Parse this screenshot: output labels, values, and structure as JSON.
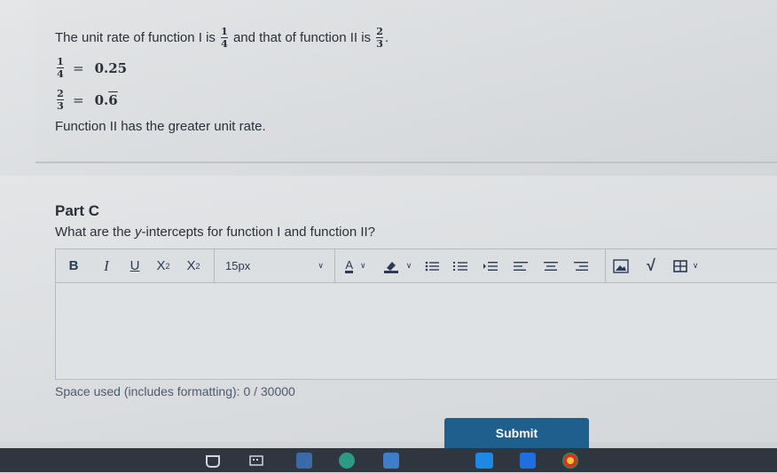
{
  "previous_answer": {
    "line1_prefix": "The unit rate of function I is",
    "line1_mid": "and that of function II is",
    "line1_end": ".",
    "frac1_num": "1",
    "frac1_den": "4",
    "frac2_num": "2",
    "frac2_den": "3",
    "row1_value": "0.25",
    "row2_value_base": "0.",
    "row2_value_repeat": "6",
    "eq_sign": "=",
    "conclusion": "Function II has the greater unit rate."
  },
  "part_c": {
    "title": "Part C",
    "question_prefix": "What are the ",
    "question_italic": "y",
    "question_suffix": "-intercepts for function I and function II?"
  },
  "toolbar": {
    "bold": "B",
    "italic": "I",
    "underline": "U",
    "superscript_base": "X",
    "superscript_exp": "2",
    "subscript_base": "X",
    "subscript_sub": "2",
    "font_size": "15px",
    "text_color_letter": "A"
  },
  "editor": {
    "value": ""
  },
  "space_used": "Space used (includes formatting): 0 / 30000",
  "submit_label": "Submit",
  "colors": {
    "accent": "#1f5f8d",
    "taskbar": "#2f3640"
  }
}
